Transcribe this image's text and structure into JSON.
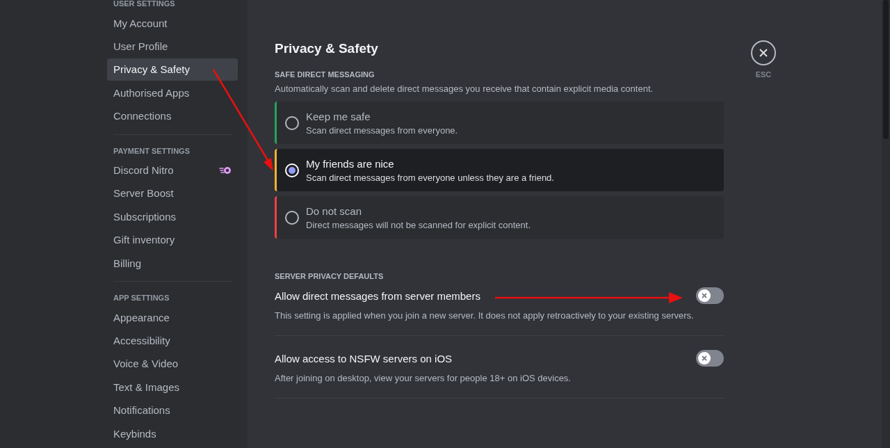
{
  "sidebar": {
    "sections": [
      {
        "header": "USER SETTINGS",
        "items": [
          {
            "label": "My Account",
            "selected": false,
            "kind": "plain"
          },
          {
            "label": "User Profile",
            "selected": false,
            "kind": "plain"
          },
          {
            "label": "Privacy & Safety",
            "selected": true,
            "kind": "plain"
          },
          {
            "label": "Authorised Apps",
            "selected": false,
            "kind": "plain"
          },
          {
            "label": "Connections",
            "selected": false,
            "kind": "plain"
          }
        ]
      },
      {
        "header": "PAYMENT SETTINGS",
        "items": [
          {
            "label": "Discord Nitro",
            "selected": false,
            "kind": "nitro"
          },
          {
            "label": "Server Boost",
            "selected": false,
            "kind": "plain"
          },
          {
            "label": "Subscriptions",
            "selected": false,
            "kind": "plain"
          },
          {
            "label": "Gift inventory",
            "selected": false,
            "kind": "plain"
          },
          {
            "label": "Billing",
            "selected": false,
            "kind": "plain"
          }
        ]
      },
      {
        "header": "APP SETTINGS",
        "items": [
          {
            "label": "Appearance",
            "selected": false,
            "kind": "plain"
          },
          {
            "label": "Accessibility",
            "selected": false,
            "kind": "plain"
          },
          {
            "label": "Voice & Video",
            "selected": false,
            "kind": "plain"
          },
          {
            "label": "Text & Images",
            "selected": false,
            "kind": "plain"
          },
          {
            "label": "Notifications",
            "selected": false,
            "kind": "plain"
          },
          {
            "label": "Keybinds",
            "selected": false,
            "kind": "plain"
          }
        ]
      }
    ]
  },
  "page": {
    "title": "Privacy & Safety",
    "safe_direct_messaging": {
      "header": "SAFE DIRECT MESSAGING",
      "description": "Automatically scan and delete direct messages you receive that contain explicit media content.",
      "options": [
        {
          "label": "Keep me safe",
          "description": "Scan direct messages from everyone.",
          "selected": false,
          "color": "#23a55a"
        },
        {
          "label": "My friends are nice",
          "description": "Scan direct messages from everyone unless they are a friend.",
          "selected": true,
          "color": "#f0b232"
        },
        {
          "label": "Do not scan",
          "description": "Direct messages will not be scanned for explicit content.",
          "selected": false,
          "color": "#f23f43"
        }
      ]
    },
    "server_privacy_defaults": {
      "header": "SERVER PRIVACY DEFAULTS",
      "settings": [
        {
          "label": "Allow direct messages from server members",
          "description": "This setting is applied when you join a new server. It does not apply retroactively to your existing servers.",
          "on": false
        },
        {
          "label": "Allow access to NSFW servers on iOS",
          "description": "After joining on desktop, view your servers for people 18+ on iOS devices.",
          "on": false
        }
      ]
    }
  },
  "close": {
    "label": "ESC"
  }
}
